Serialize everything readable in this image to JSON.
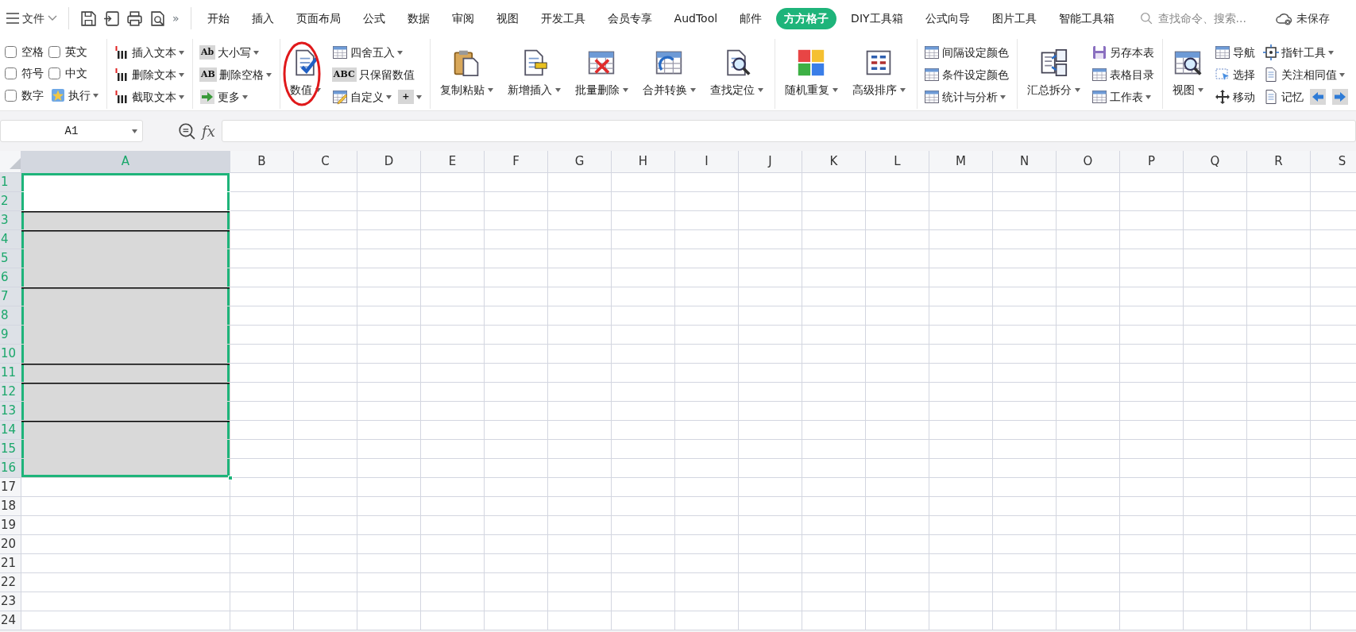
{
  "quick_bar": {
    "menu_label": "文件",
    "more": "»"
  },
  "tabs": [
    {
      "label": "开始",
      "selected": false
    },
    {
      "label": "插入",
      "selected": false
    },
    {
      "label": "页面布局",
      "selected": false
    },
    {
      "label": "公式",
      "selected": false
    },
    {
      "label": "数据",
      "selected": false
    },
    {
      "label": "审阅",
      "selected": false
    },
    {
      "label": "视图",
      "selected": false
    },
    {
      "label": "开发工具",
      "selected": false
    },
    {
      "label": "会员专享",
      "selected": false
    },
    {
      "label": "AudTool",
      "selected": false
    },
    {
      "label": "邮件",
      "selected": false
    },
    {
      "label": "方方格子",
      "selected": true
    },
    {
      "label": "DIY工具箱",
      "selected": false
    },
    {
      "label": "公式向导",
      "selected": false
    },
    {
      "label": "图片工具",
      "selected": false
    },
    {
      "label": "智能工具箱",
      "selected": false
    }
  ],
  "search": {
    "placeholder": "查找命令、搜索..."
  },
  "save_status": "未保存",
  "ribbon": {
    "groups": [
      {
        "columns": [
          [
            [
              {
                "kind": "check",
                "label": "空格",
                "checked": false
              }
            ],
            [
              {
                "kind": "check",
                "label": "符号",
                "checked": false
              }
            ],
            [
              {
                "kind": "check",
                "label": "数字",
                "checked": false
              }
            ]
          ],
          [
            [
              {
                "kind": "check",
                "label": "英文",
                "checked": false
              }
            ],
            [
              {
                "kind": "check",
                "label": "中文",
                "checked": false
              }
            ],
            [
              {
                "kind": "small",
                "label": "执行",
                "dropdown": true
              }
            ]
          ]
        ]
      },
      {
        "columns": [
          [
            [
              {
                "kind": "small",
                "label": "插入文本",
                "dropdown": true
              }
            ],
            [
              {
                "kind": "small",
                "label": "删除文本",
                "dropdown": true
              }
            ],
            [
              {
                "kind": "small",
                "label": "截取文本",
                "dropdown": true
              }
            ]
          ]
        ]
      },
      {
        "columns": [
          [
            [
              {
                "kind": "badge",
                "icon_text": "Ab",
                "label": "大小写",
                "dropdown": true
              }
            ],
            [
              {
                "kind": "badge",
                "icon_text": "AB",
                "label": "删除空格",
                "dropdown": true
              }
            ],
            [
              {
                "kind": "small",
                "label": "更多",
                "dropdown": true
              }
            ]
          ]
        ]
      },
      {
        "columns": [
          [
            [
              {
                "kind": "large",
                "label": "数值",
                "dropdown": true,
                "circled": true
              }
            ]
          ],
          [
            [
              {
                "kind": "small",
                "label": "四舍五入",
                "dropdown": true
              }
            ],
            [
              {
                "kind": "badge",
                "icon_text": "ABC",
                "label": "只保留数值",
                "dropdown": false
              }
            ],
            [
              {
                "kind": "small",
                "label": "自定义",
                "dropdown": true
              },
              {
                "kind": "badge",
                "icon_text": "+",
                "dropdown": true
              }
            ]
          ]
        ]
      },
      {
        "columns": [
          [
            [
              {
                "kind": "large",
                "label": "复制粘贴",
                "dropdown": true,
                "circled": false
              }
            ]
          ],
          [
            [
              {
                "kind": "large",
                "label": "新增插入",
                "dropdown": true,
                "circled": false
              }
            ]
          ],
          [
            [
              {
                "kind": "large",
                "label": "批量删除",
                "dropdown": true,
                "circled": false
              }
            ]
          ],
          [
            [
              {
                "kind": "large",
                "label": "合并转换",
                "dropdown": true,
                "circled": false
              }
            ]
          ],
          [
            [
              {
                "kind": "large",
                "label": "查找定位",
                "dropdown": true,
                "circled": false
              }
            ]
          ]
        ]
      },
      {
        "columns": [
          [
            [
              {
                "kind": "large",
                "label": "随机重复",
                "dropdown": true,
                "circled": false
              }
            ]
          ],
          [
            [
              {
                "kind": "large",
                "label": "高级排序",
                "dropdown": true,
                "circled": false
              }
            ]
          ]
        ]
      },
      {
        "columns": [
          [
            [
              {
                "kind": "small",
                "label": "间隔设定颜色",
                "dropdown": false
              }
            ],
            [
              {
                "kind": "small",
                "label": "条件设定颜色",
                "dropdown": false
              }
            ],
            [
              {
                "kind": "small",
                "label": "统计与分析",
                "dropdown": true
              }
            ]
          ]
        ]
      },
      {
        "columns": [
          [
            [
              {
                "kind": "large",
                "label": "汇总拆分",
                "dropdown": true,
                "circled": false
              }
            ]
          ],
          [
            [
              {
                "kind": "small",
                "label": "另存本表",
                "dropdown": false
              }
            ],
            [
              {
                "kind": "small",
                "label": "表格目录",
                "dropdown": false
              }
            ],
            [
              {
                "kind": "small",
                "label": "工作表",
                "dropdown": true
              }
            ]
          ]
        ]
      },
      {
        "columns": [
          [
            [
              {
                "kind": "large",
                "label": "视图",
                "dropdown": true,
                "circled": false
              }
            ]
          ],
          [
            [
              {
                "kind": "small",
                "label": "导航",
                "dropdown": false
              }
            ],
            [
              {
                "kind": "small",
                "label": "选择",
                "dropdown": false
              }
            ],
            [
              {
                "kind": "small",
                "label": "移动",
                "dropdown": false
              }
            ]
          ],
          [
            [
              {
                "kind": "small",
                "label": "指针工具",
                "dropdown": true
              }
            ],
            [
              {
                "kind": "small",
                "label": "关注相同值",
                "dropdown": true
              }
            ],
            [
              {
                "kind": "small",
                "label": "记忆",
                "dropdown": false
              },
              {
                "kind": "icon",
                "dropdown": false
              },
              {
                "kind": "icon",
                "dropdown": false
              }
            ]
          ]
        ]
      }
    ]
  },
  "formula_bar": {
    "cell_ref": "A1",
    "function_label": "fx"
  },
  "sheet": {
    "columns": [
      {
        "label": "A",
        "selected": true
      },
      {
        "label": "B",
        "selected": false
      },
      {
        "label": "C",
        "selected": false
      },
      {
        "label": "D",
        "selected": false
      },
      {
        "label": "E",
        "selected": false
      },
      {
        "label": "F",
        "selected": false
      },
      {
        "label": "G",
        "selected": false
      },
      {
        "label": "H",
        "selected": false
      },
      {
        "label": "I",
        "selected": false
      },
      {
        "label": "J",
        "selected": false
      },
      {
        "label": "K",
        "selected": false
      },
      {
        "label": "L",
        "selected": false
      },
      {
        "label": "M",
        "selected": false
      },
      {
        "label": "N",
        "selected": false
      },
      {
        "label": "O",
        "selected": false
      },
      {
        "label": "P",
        "selected": false
      },
      {
        "label": "Q",
        "selected": false
      },
      {
        "label": "R",
        "selected": false
      },
      {
        "label": "S",
        "selected": false
      }
    ],
    "rows": [
      {
        "label": "1",
        "selected": true,
        "shaded": false,
        "rule_above": false
      },
      {
        "label": "2",
        "selected": true,
        "shaded": false,
        "rule_above": false
      },
      {
        "label": "3",
        "selected": true,
        "shaded": true,
        "rule_above": true
      },
      {
        "label": "4",
        "selected": true,
        "shaded": true,
        "rule_above": true
      },
      {
        "label": "5",
        "selected": true,
        "shaded": true,
        "rule_above": false
      },
      {
        "label": "6",
        "selected": true,
        "shaded": true,
        "rule_above": false
      },
      {
        "label": "7",
        "selected": true,
        "shaded": true,
        "rule_above": true
      },
      {
        "label": "8",
        "selected": true,
        "shaded": true,
        "rule_above": false
      },
      {
        "label": "9",
        "selected": true,
        "shaded": true,
        "rule_above": false
      },
      {
        "label": "10",
        "selected": true,
        "shaded": true,
        "rule_above": false
      },
      {
        "label": "11",
        "selected": true,
        "shaded": true,
        "rule_above": true
      },
      {
        "label": "12",
        "selected": true,
        "shaded": true,
        "rule_above": true
      },
      {
        "label": "13",
        "selected": true,
        "shaded": true,
        "rule_above": false
      },
      {
        "label": "14",
        "selected": true,
        "shaded": true,
        "rule_above": true
      },
      {
        "label": "15",
        "selected": true,
        "shaded": true,
        "rule_above": false
      },
      {
        "label": "16",
        "selected": true,
        "shaded": true,
        "rule_above": false
      },
      {
        "label": "17",
        "selected": false,
        "shaded": false,
        "rule_above": false
      },
      {
        "label": "18",
        "selected": false,
        "shaded": false,
        "rule_above": false
      },
      {
        "label": "19",
        "selected": false,
        "shaded": false,
        "rule_above": false
      },
      {
        "label": "20",
        "selected": false,
        "shaded": false,
        "rule_above": false
      },
      {
        "label": "21",
        "selected": false,
        "shaded": false,
        "rule_above": false
      },
      {
        "label": "22",
        "selected": false,
        "shaded": false,
        "rule_above": false
      },
      {
        "label": "23",
        "selected": false,
        "shaded": false,
        "rule_above": false
      },
      {
        "label": "24",
        "selected": false,
        "shaded": false,
        "rule_above": false
      }
    ]
  }
}
